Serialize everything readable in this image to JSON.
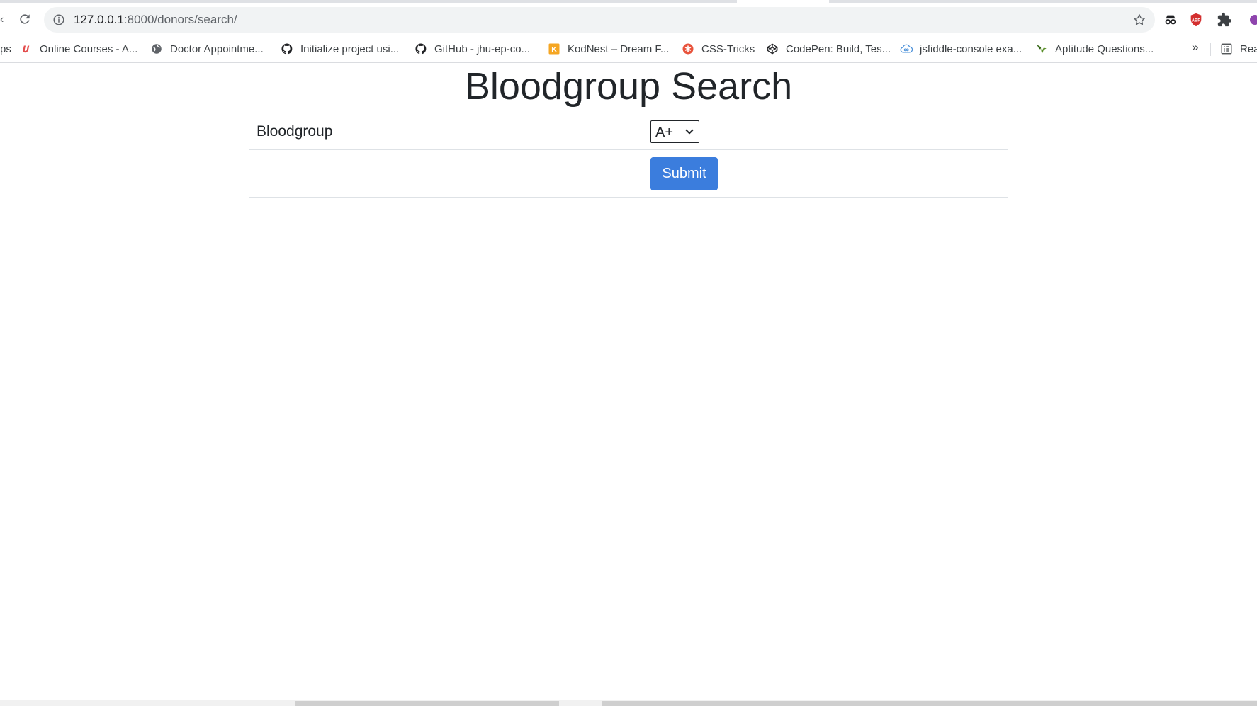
{
  "browser": {
    "url_host": "127.0.0.1",
    "url_rest": ":8000/donors/search/",
    "back_partial": "‹"
  },
  "bookmarks": [
    {
      "label": "Online Courses - A...",
      "icon": "udemy-icon",
      "color": "#e34c4c"
    },
    {
      "label": "Doctor Appointme...",
      "icon": "globe-icon",
      "color": "#5f6368"
    },
    {
      "label": "Initialize project usi...",
      "icon": "github-icon",
      "color": "#202124"
    },
    {
      "label": "GitHub - jhu-ep-co...",
      "icon": "github-icon",
      "color": "#202124"
    },
    {
      "label": "KodNest – Dream F...",
      "icon": "kodnest-icon",
      "color": "#f5a623"
    },
    {
      "label": "CSS-Tricks",
      "icon": "css-tricks-icon",
      "color": "#e8533c"
    },
    {
      "label": "CodePen: Build, Tes...",
      "icon": "codepen-icon",
      "color": "#202124"
    },
    {
      "label": "jsfiddle-console exa...",
      "icon": "cloud-icon",
      "color": "#4a90d9"
    },
    {
      "label": "Aptitude Questions...",
      "icon": "indiabix-icon",
      "color": "#5a8f29"
    }
  ],
  "bookmarks_overflow": "»",
  "reading_list_partial": "Rea",
  "leading_partial": "ps",
  "page": {
    "title": "Bloodgroup Search",
    "field_label": "Bloodgroup",
    "select_value": "A+",
    "submit_label": "Submit"
  },
  "colors": {
    "submit": "#3b7ddd",
    "text": "#212529"
  }
}
